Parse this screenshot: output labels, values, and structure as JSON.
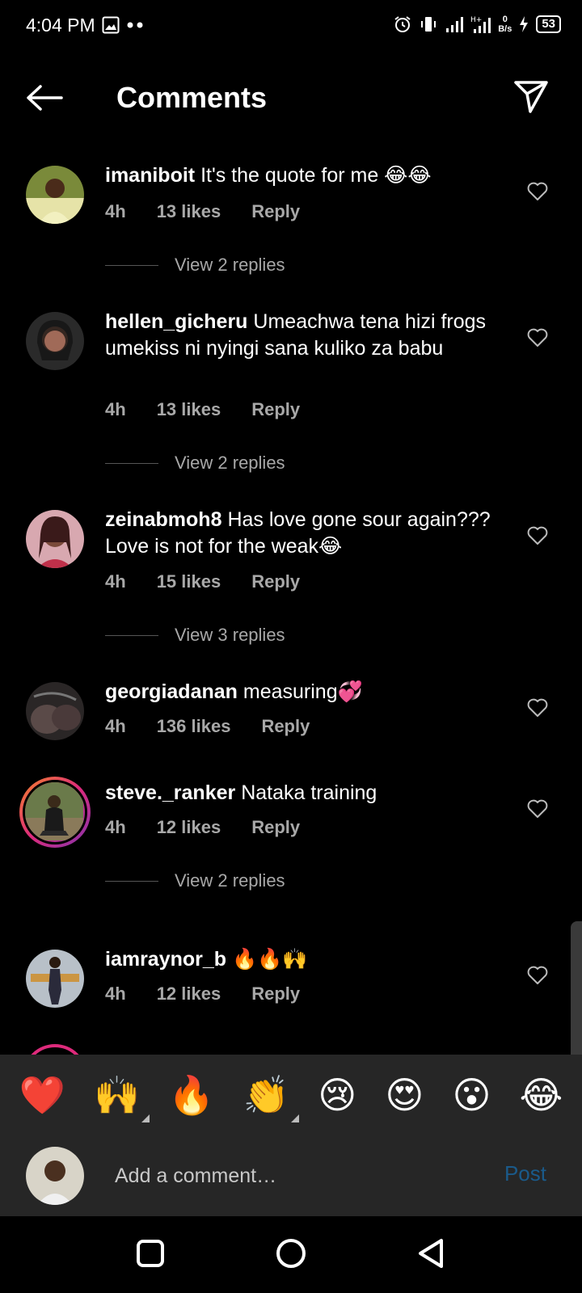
{
  "status_bar": {
    "time": "4:04 PM",
    "netspeed_value": "0",
    "netspeed_unit": "B/s",
    "battery": "53"
  },
  "header": {
    "title": "Comments"
  },
  "comments": [
    {
      "username": "imaniboit",
      "text": "It's the quote for me 😂😂",
      "time": "4h",
      "likes": "13 likes",
      "reply": "Reply",
      "view_replies": "View 2 replies"
    },
    {
      "username": "hellen_gicheru",
      "text": "Umeachwa tena hizi frogs umekiss ni nyingi sana kuliko za babu",
      "time": "4h",
      "likes": "13 likes",
      "reply": "Reply",
      "view_replies": "View 2 replies"
    },
    {
      "username": "zeinabmoh8",
      "text": "Has love gone sour again???Love is not for the weak😂",
      "time": "4h",
      "likes": "15 likes",
      "reply": "Reply",
      "view_replies": "View 3 replies"
    },
    {
      "username": "georgiadanan",
      "text": "measuring💞",
      "time": "4h",
      "likes": "136 likes",
      "reply": "Reply",
      "view_replies": ""
    },
    {
      "username": "steve._ranker",
      "text": "Nataka training",
      "time": "4h",
      "likes": "12 likes",
      "reply": "Reply",
      "view_replies": "View 2 replies"
    },
    {
      "username": "iamraynor_b",
      "text": "🔥🔥🙌",
      "time": "4h",
      "likes": "12 likes",
      "reply": "Reply",
      "view_replies": ""
    }
  ],
  "emoji_bar": [
    "❤️",
    "🙌",
    "🔥",
    "👏",
    "😢",
    "😍",
    "😮",
    "😂"
  ],
  "comment_input": {
    "placeholder": "Add a comment…",
    "post_label": "Post"
  },
  "colors": {
    "background": "#000000",
    "panel": "#262626",
    "muted_text": "#a8a8a8",
    "post_disabled": "#1a5a8a",
    "heart": "#e0233b"
  }
}
